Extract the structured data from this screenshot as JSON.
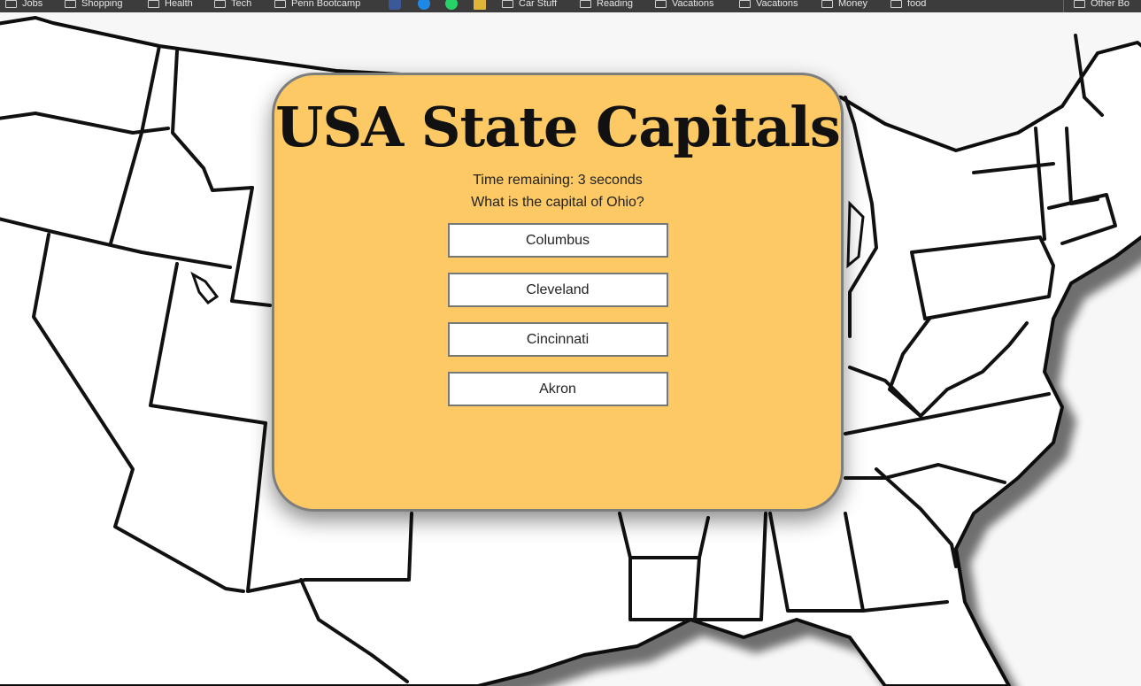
{
  "bookmarks_bar": {
    "items": [
      {
        "label": "Jobs",
        "icon": "folder-icon"
      },
      {
        "label": "Shopping",
        "icon": "folder-icon"
      },
      {
        "label": "Health",
        "icon": "folder-icon"
      },
      {
        "label": "Tech",
        "icon": "folder-icon"
      },
      {
        "label": "Penn Bootcamp",
        "icon": "folder-icon"
      },
      {
        "label": "",
        "icon": "facebook-icon",
        "color": "#3b5998"
      },
      {
        "label": "",
        "icon": "messenger-icon",
        "color": "#1e88e5"
      },
      {
        "label": "",
        "icon": "whatsapp-icon",
        "color": "#25d366"
      },
      {
        "label": "",
        "icon": "ruler-icon",
        "color": "#e0b53a"
      },
      {
        "label": "Car Stuff",
        "icon": "folder-icon"
      },
      {
        "label": "Reading",
        "icon": "folder-icon"
      },
      {
        "label": "Vacations",
        "icon": "folder-icon"
      },
      {
        "label": "Vacations",
        "icon": "folder-icon"
      },
      {
        "label": "Money",
        "icon": "folder-icon"
      },
      {
        "label": "food",
        "icon": "folder-icon"
      }
    ],
    "other_label": "Other Bo"
  },
  "quiz": {
    "title": "USA State Capitals",
    "timer_text": "Time remaining: 3 seconds",
    "question": "What is the capital of Ohio?",
    "answers": [
      "Columbus",
      "Cleveland",
      "Cincinnati",
      "Akron"
    ]
  },
  "colors": {
    "card_background": "#fcc964",
    "card_border": "#7e7e7e",
    "map_outline": "#111111",
    "page_background": "#f7f7f7"
  },
  "background_image": "usa-states-outline-map"
}
